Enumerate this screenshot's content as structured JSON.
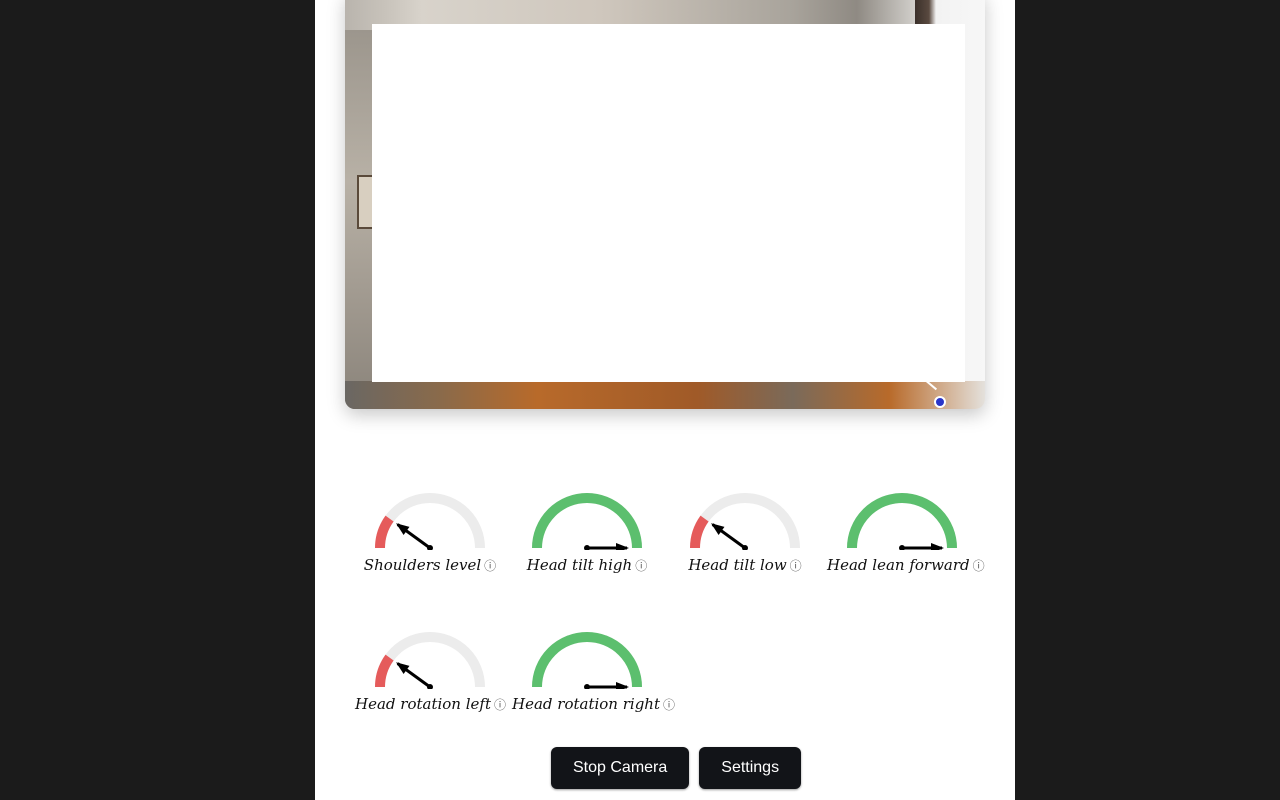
{
  "camera": {
    "overlay_color": "#ffffff",
    "landmark_color": "#2b36c9"
  },
  "gauges": [
    {
      "label": "Shoulders level",
      "status": "bad",
      "value": 0.2,
      "info_icon": "ⓘ"
    },
    {
      "label": "Head tilt high",
      "status": "good",
      "value": 1.0,
      "info_icon": "ⓘ"
    },
    {
      "label": "Head tilt low",
      "status": "bad",
      "value": 0.2,
      "info_icon": "ⓘ"
    },
    {
      "label": "Head lean forward",
      "status": "good",
      "value": 1.0,
      "info_icon": "ⓘ"
    },
    {
      "label": "Head rotation left",
      "status": "bad",
      "value": 0.2,
      "info_icon": "ⓘ"
    },
    {
      "label": "Head rotation right",
      "status": "good",
      "value": 1.0,
      "info_icon": "ⓘ"
    }
  ],
  "colors": {
    "good": "#5cbf6e",
    "bad": "#e55b5b",
    "track": "#ececec"
  },
  "buttons": {
    "stop_camera": "Stop Camera",
    "settings": "Settings"
  }
}
